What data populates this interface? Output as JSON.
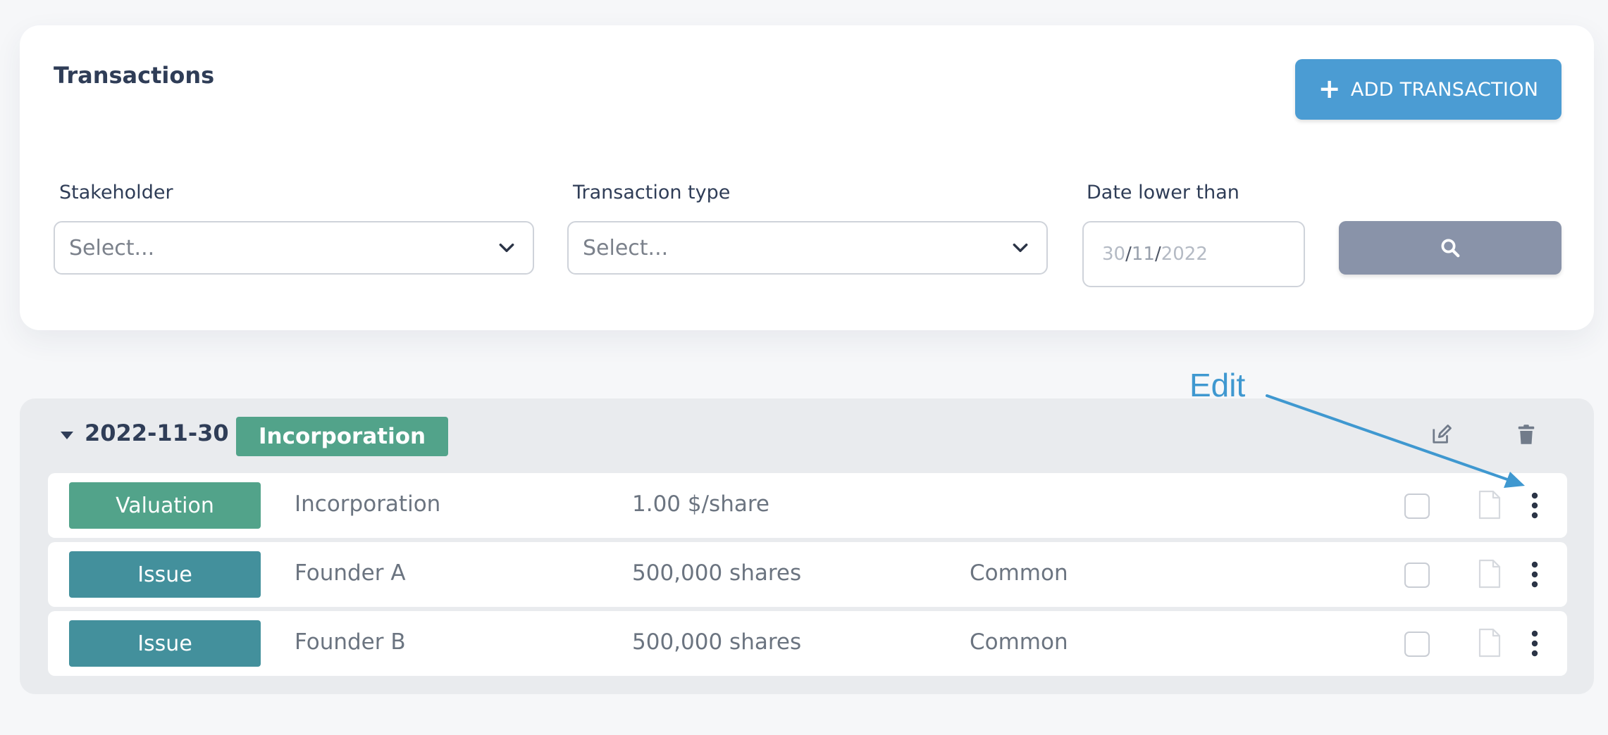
{
  "filters_card": {
    "title": "Transactions",
    "add_button_label": "ADD TRANSACTION",
    "add_button_icon": "plus-icon",
    "stakeholder": {
      "label": "Stakeholder",
      "placeholder": "Select..."
    },
    "transaction_type": {
      "label": "Transaction type",
      "placeholder": "Select..."
    },
    "date_lower_than": {
      "label": "Date lower than",
      "day": "30",
      "month": "11",
      "year": "2022",
      "separator": "/"
    },
    "search_button_icon": "search-icon"
  },
  "group": {
    "date": "2022-11-30",
    "badge": "Incorporation",
    "badge_color": "#52a38a",
    "actions": [
      "edit-icon",
      "trash-icon"
    ],
    "rows": [
      {
        "type": "Valuation",
        "type_color": "#52a38a",
        "party": "Incorporation",
        "amount": "1.00 $/share",
        "class": ""
      },
      {
        "type": "Issue",
        "type_color": "#43909c",
        "party": "Founder A",
        "amount": "500,000 shares",
        "class": "Common"
      },
      {
        "type": "Issue",
        "type_color": "#43909c",
        "party": "Founder B",
        "amount": "500,000 shares",
        "class": "Common"
      }
    ]
  },
  "annotation": {
    "text": "Edit",
    "color": "#3f98d0"
  },
  "colors": {
    "primary": "#4b9cd3",
    "search_button": "#8993a9",
    "group_background": "#e9ebee"
  }
}
